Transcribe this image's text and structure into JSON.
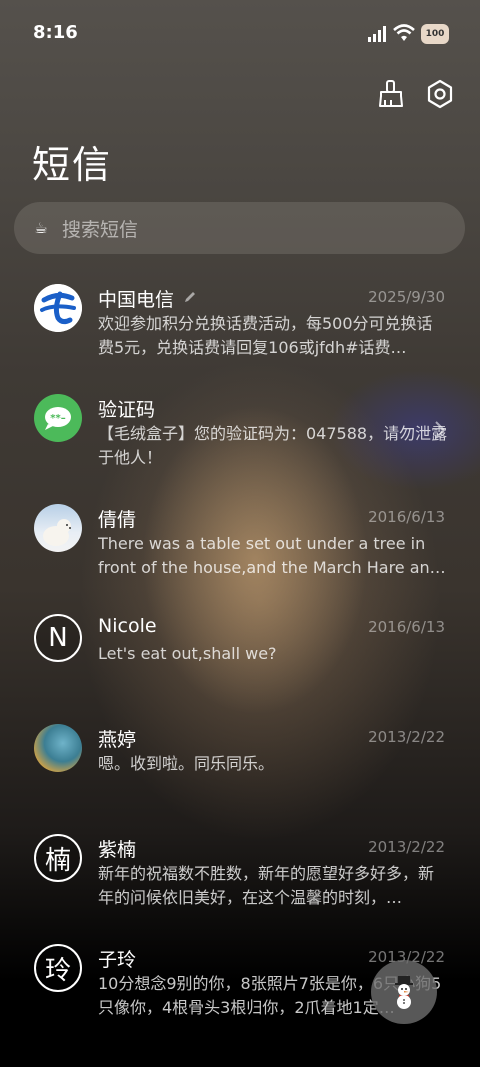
{
  "status_bar": {
    "time": "8:16",
    "battery": "100"
  },
  "header": {
    "title": "短信"
  },
  "search": {
    "placeholder": "搜索短信"
  },
  "conversations": [
    {
      "name": "中国电信",
      "date": "2025/9/30",
      "preview": "欢迎参加积分兑换话费活动，每500分可兑换话费5元，兑换话费请回复106或jfdh#话费…",
      "avatar": "china-telecom-logo"
    },
    {
      "name": "验证码",
      "date": "",
      "preview": "【毛绒盒子】您的验证码为：047588，请勿泄露于他人！",
      "avatar": "verification-code-icon"
    },
    {
      "name": "倩倩",
      "date": "2016/6/13",
      "preview": "There was a table set out under a tree in front of the house,and the March Hare an…",
      "avatar": "polar-bear-photo"
    },
    {
      "name": "Nicole",
      "date": "2016/6/13",
      "preview": "Let's eat out,shall we?",
      "avatar_letter": "N"
    },
    {
      "name": "燕婷",
      "date": "2013/2/22",
      "preview": "嗯。收到啦。同乐同乐。",
      "avatar": "landscape-photo"
    },
    {
      "name": "紫楠",
      "date": "2013/2/22",
      "preview": "新年的祝福数不胜数，新年的愿望好多好多，新年的问候依旧美好，在这个温馨的时刻，…",
      "avatar_letter": "楠"
    },
    {
      "name": "子玲",
      "date": "2013/2/22",
      "preview": "10分想念9别的你，8张照片7张是你，6只小狗5只像你，4根骨头3根归你，2爪着地1定…",
      "avatar_letter": "玲"
    }
  ],
  "colors": {
    "telecom_blue": "#1a5fc8",
    "verify_green": "#4cba5a"
  }
}
